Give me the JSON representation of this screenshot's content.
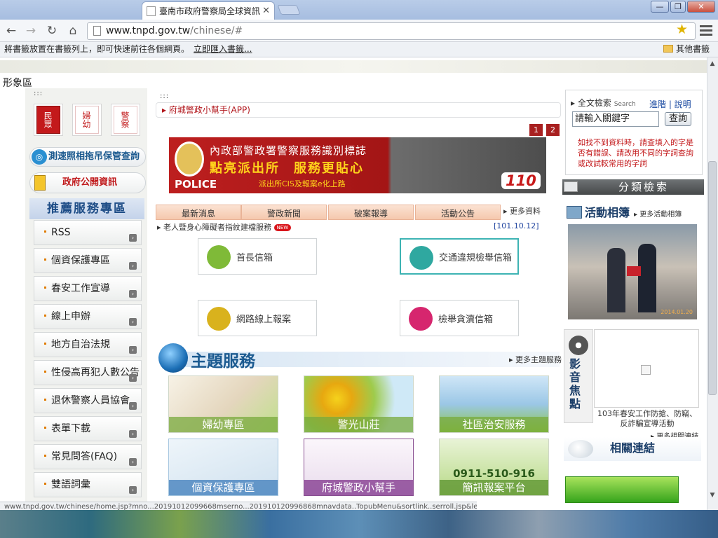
{
  "browser": {
    "tab_title": "臺南市政府警察局全球資訊",
    "tab_close": "✕",
    "url_host": "www.tnpd.gov.tw",
    "url_path": "/chinese/#",
    "bookmark_prompt": "將書籤放置在書籤列上，即可快速前往各個網頁。",
    "bookmark_import": "立即匯入書籤...",
    "other_bookmarks": "其他書籤",
    "win_min": "—",
    "win_max": "❐",
    "win_close": "✕",
    "back": "←",
    "forward": "→",
    "reload": "↻",
    "home": "⌂",
    "star": "★",
    "status_url": "www.tnpd.gov.tw/chinese/home.jsp?mno...20191012099668mserno...201910120996868mnavdata..TopubMenu&sortlink..serroll.jsp&level2..Y"
  },
  "page": {
    "image_zone": "形象區",
    "dots": ":::",
    "roles": [
      "民眾",
      "婦幼",
      "警察"
    ],
    "lost_found": "測速照相拖吊保管查詢",
    "public_info": "政府公開資訊",
    "reco_title": "推薦服務專區",
    "left_items": [
      "RSS",
      "個資保護專區",
      "春安工作宣導",
      "線上申辦",
      "地方自治法規",
      "性侵高再犯人數公告",
      "退休警察人員協會",
      "表單下載",
      "常見問答(FAQ)",
      "雙語詞彙"
    ],
    "app_line": "府城警政小幫手(APP)",
    "pager": [
      "1",
      "2"
    ],
    "banner": {
      "line1": "內政部警政署警察服務識別標誌",
      "line2": "點亮派出所　服務更貼心",
      "line3": "派出所CIS及報案e化上路",
      "line4": "POLICE",
      "line5": "110"
    },
    "news_tabs": [
      "最新消息",
      "警政新聞",
      "破案報導",
      "活動公告"
    ],
    "more_info": "更多資料",
    "news_item": "老人暨身心障礙者指紋建檔服務",
    "news_badge": "NEW",
    "news_date": "[101.10.12]",
    "mailboxes": [
      "首長信箱",
      "交通違規檢舉信箱",
      "網路線上報案",
      "檢舉貪瀆信箱"
    ],
    "theme_title": "主題服務",
    "more_theme": "更多主題服務",
    "theme_cards": [
      "婦幼專區",
      "警光山莊",
      "社區治安服務",
      "個資保護專區",
      "府城警政小幫手",
      "0911-510-916",
      "簡訊報案平台"
    ],
    "search": {
      "title": "全文檢索",
      "title_en": "Search",
      "advanced": "進階 | 說明",
      "input_value": "請輸入關鍵字",
      "button": "查詢",
      "help": "如找不到資料時，請查填入的字是否有錯誤、請改用不同的字詞查詢或改試較常用的字詞"
    },
    "category_search": "分類檢索",
    "album_title": "活動相簿",
    "album_more": "更多活動相簿",
    "album_date": "2014.01.20",
    "video_label": "影音焦點",
    "video_caption": "103年春安工作防搶、防竊、反詐騙宣導活動",
    "video_more": "更多相關連結",
    "links_title": "相關連結"
  },
  "colors": {
    "accent_red": "#c3191b",
    "header_blue": "#1d4c86"
  }
}
